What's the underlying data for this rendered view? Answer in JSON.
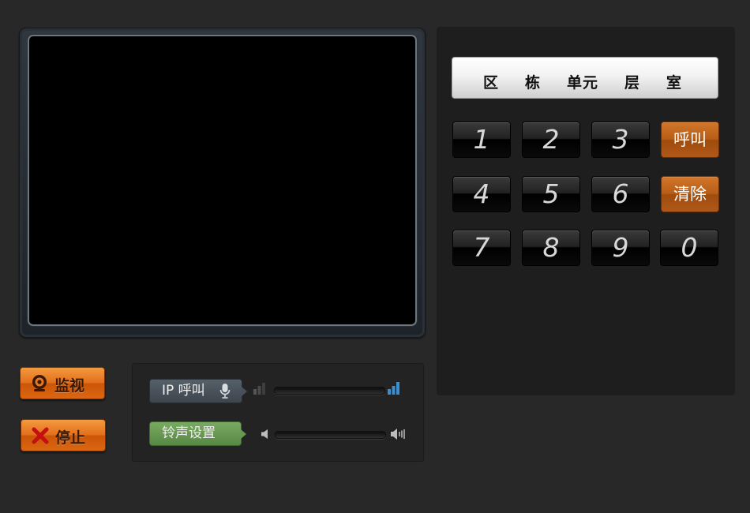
{
  "video": {
    "state": "no-signal"
  },
  "address": {
    "labels": [
      "区",
      "栋",
      "单元",
      "层",
      "室"
    ]
  },
  "keypad": {
    "keys": [
      "1",
      "2",
      "3",
      "4",
      "5",
      "6",
      "7",
      "8",
      "9",
      "0"
    ],
    "call_label": "呼叫",
    "clear_label": "清除"
  },
  "controls": {
    "monitor_label": "监视",
    "monitor_icon": "webcam-icon",
    "stop_label": "停止",
    "stop_icon": "x-icon"
  },
  "audio": {
    "ip_call_label": "IP 呼叫",
    "ip_call_icon": "microphone-icon",
    "ip_call_level": 0,
    "ring_label": "铃声设置",
    "ring_icon_low": "volume-low-icon",
    "ring_icon_high": "volume-high-icon",
    "ring_level": 0
  },
  "colors": {
    "accent_orange": "#e3701d",
    "call_orange": "#b85d16",
    "ring_green": "#6a9a53",
    "signal_blue": "#3a8fd0"
  }
}
